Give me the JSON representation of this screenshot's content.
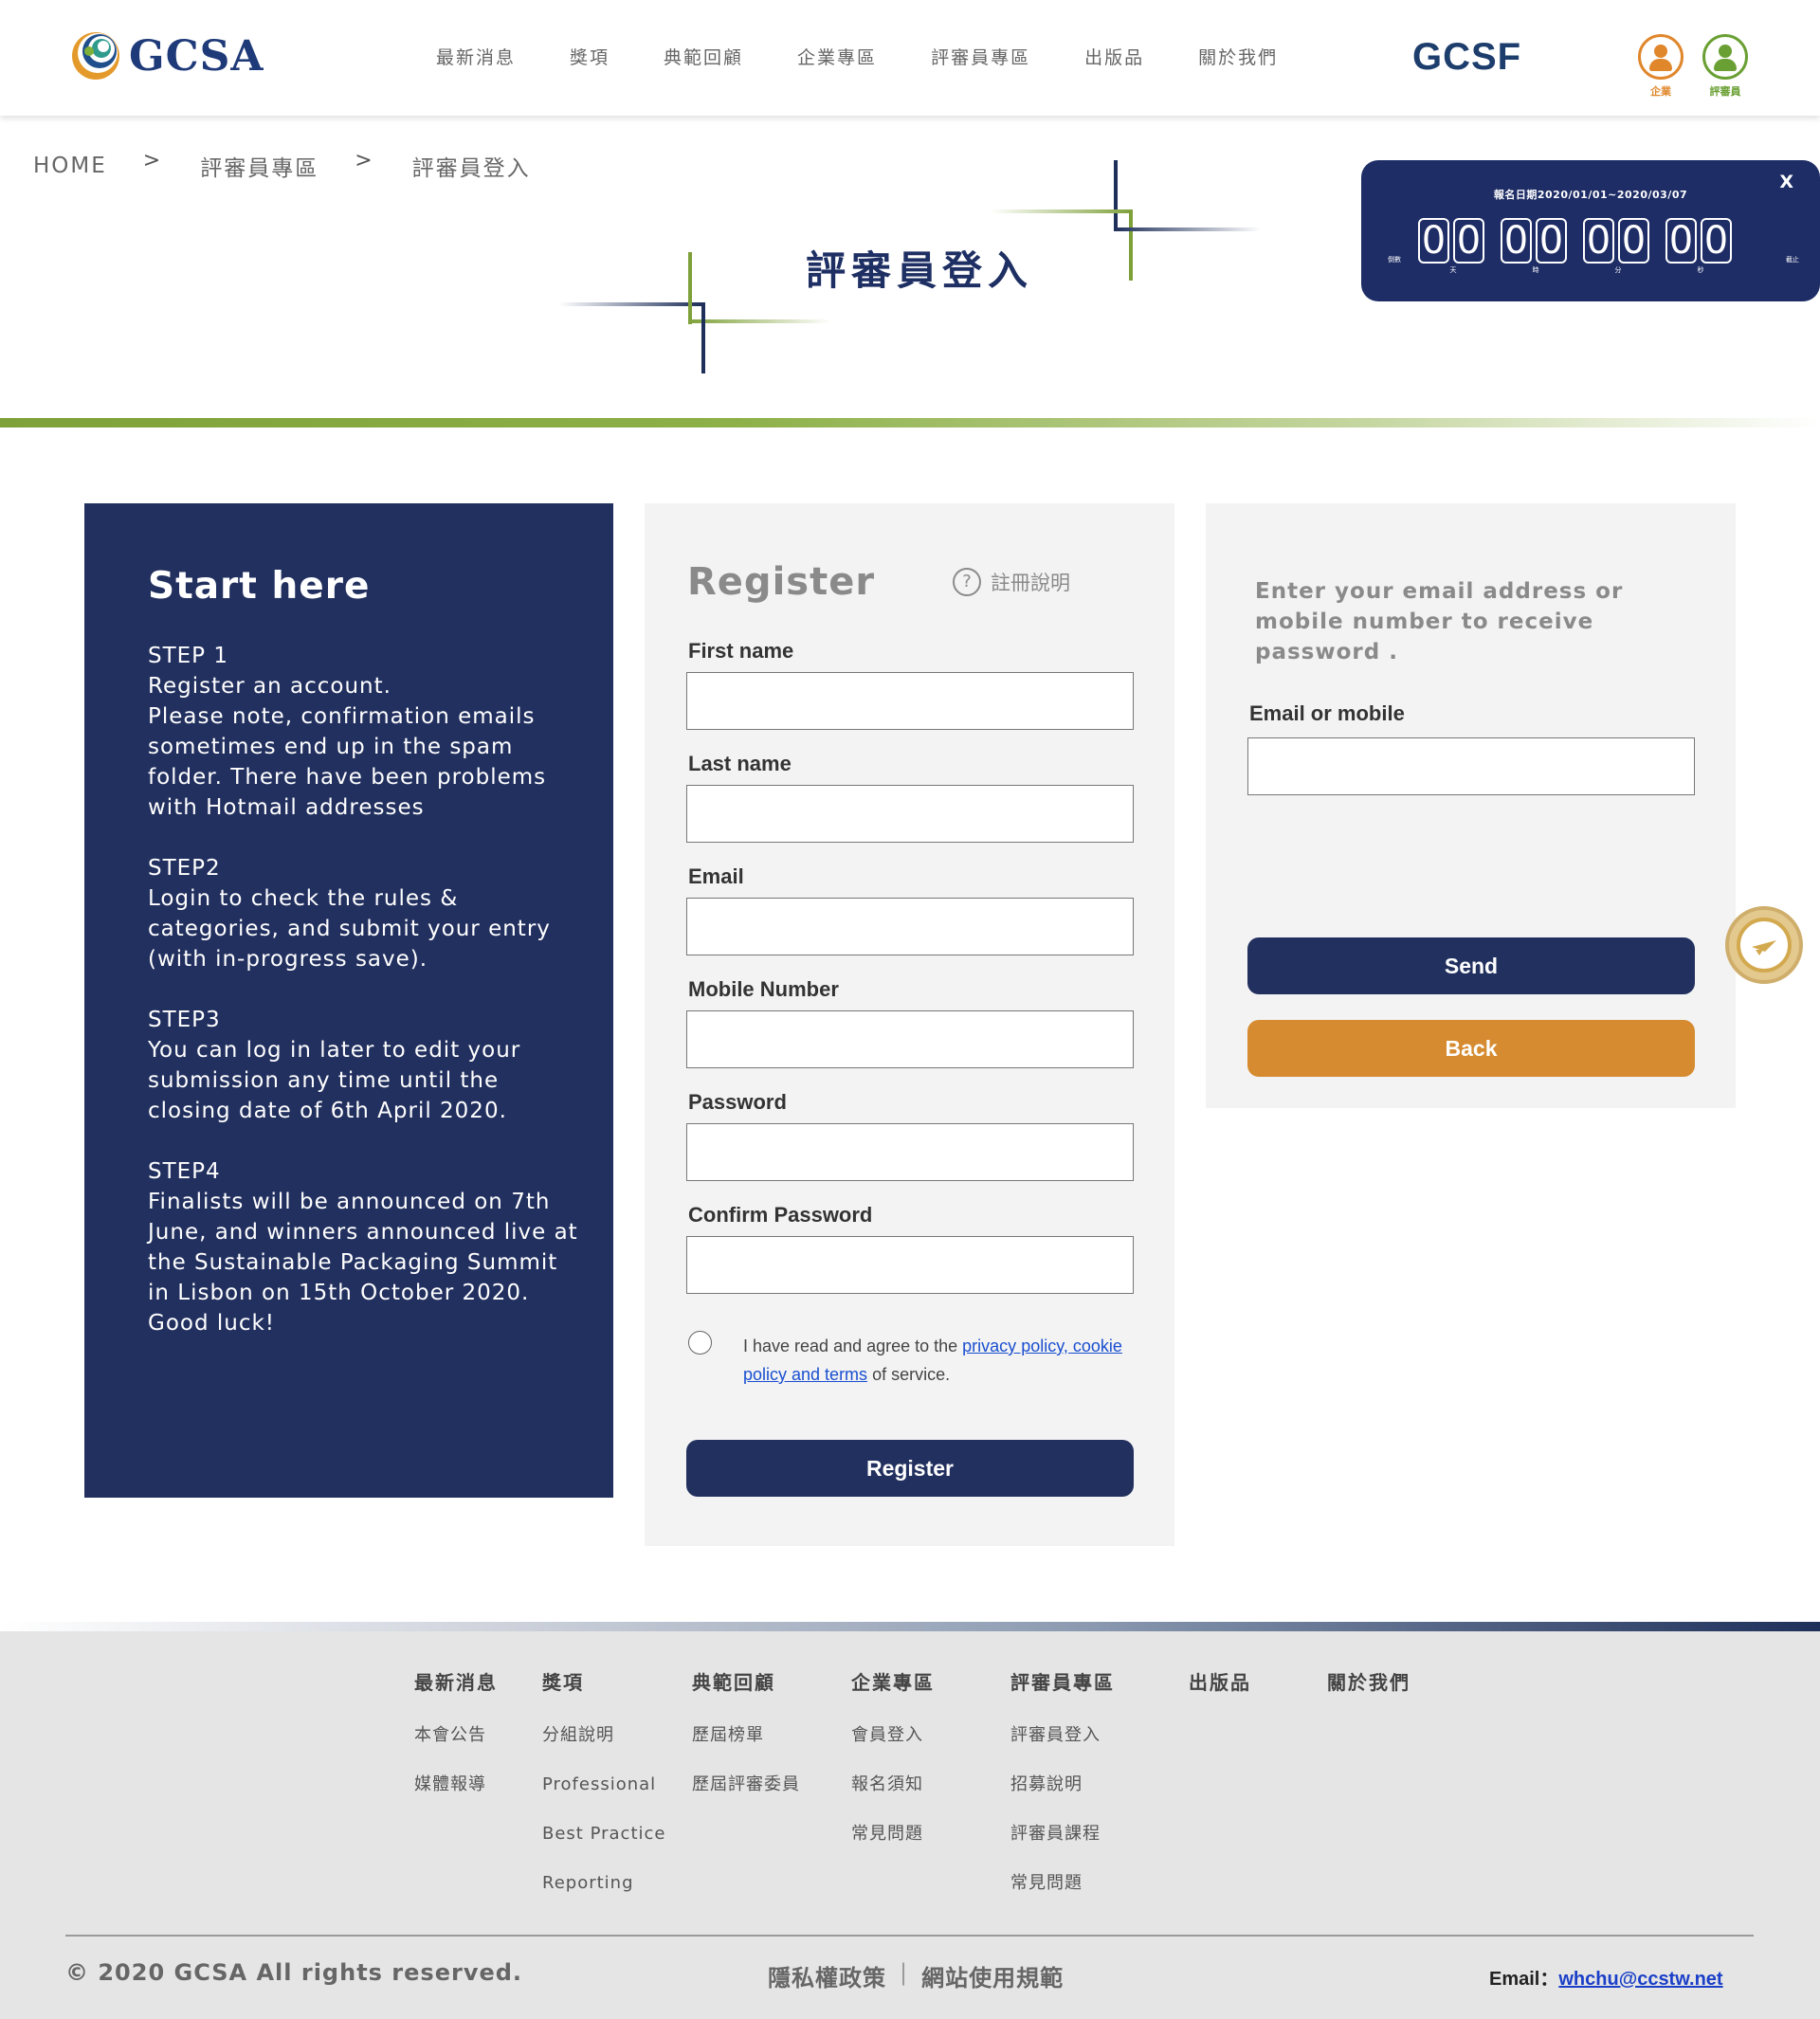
{
  "header": {
    "logo_text": "GCSA",
    "nav": [
      "最新消息",
      "獎項",
      "典範回顧",
      "企業專區",
      "評審員專區",
      "出版品",
      "關於我們"
    ],
    "partner_logo": "GCSF",
    "user_buttons": [
      {
        "label": "企業",
        "icon": "user-icon",
        "color": "#e0872c"
      },
      {
        "label": "評審員",
        "icon": "user-icon",
        "color": "#6aa033"
      }
    ]
  },
  "breadcrumb": {
    "items": [
      "HOME",
      "評審員專區",
      "評審員登入"
    ],
    "separator": ">"
  },
  "page_title": "評審員登入",
  "countdown": {
    "date_range": "報名日期2020/01/01~2020/03/07",
    "close": "X",
    "left_label": "倒數",
    "right_label": "截止",
    "groups": [
      {
        "value": "00",
        "unit": "天"
      },
      {
        "value": "00",
        "unit": "時"
      },
      {
        "value": "00",
        "unit": "分"
      },
      {
        "value": "00",
        "unit": "秒"
      }
    ]
  },
  "start": {
    "title": "Start here",
    "steps": [
      {
        "heading": "STEP 1",
        "text": "Register an account.\nPlease note, confirmation emails sometimes end up in the spam folder. There have been problems with Hotmail addresses"
      },
      {
        "heading": "STEP2",
        "text": "Login to check the rules & categories, and submit your entry (with in-progress save)."
      },
      {
        "heading": "STEP3",
        "text": "You can log in later to edit your submission any time until the closing date of 6th April 2020."
      },
      {
        "heading": "STEP4",
        "text": "Finalists will be announced on 7th June, and winners announced live at the Sustainable Packaging Summit in Lisbon on 15th October 2020.\nGood luck!"
      }
    ]
  },
  "register": {
    "title": "Register",
    "help_label": "註冊說明",
    "fields": [
      {
        "label": "First name",
        "value": "",
        "placeholder": ""
      },
      {
        "label": "Last name",
        "value": "",
        "placeholder": ""
      },
      {
        "label": "Email",
        "value": "",
        "placeholder": ""
      },
      {
        "label": "Mobile Number",
        "value": "",
        "placeholder": ""
      },
      {
        "label": "Password",
        "value": "",
        "placeholder": ""
      },
      {
        "label": "Confirm Password",
        "value": "",
        "placeholder": ""
      }
    ],
    "agree_prefix": "I have read and agree to the ",
    "agree_link": "privacy policy, cookie policy and terms",
    "agree_suffix": " of service.",
    "agree_checked": false,
    "submit_label": "Register"
  },
  "recover": {
    "prompt": "Enter your email address or mobile number to receive password .",
    "field_label": "Email or mobile",
    "field_value": "",
    "send_label": "Send",
    "back_label": "Back"
  },
  "footer": {
    "columns": [
      {
        "heading": "最新消息",
        "links": [
          "本會公告",
          "媒體報導"
        ]
      },
      {
        "heading": "獎項",
        "links": [
          "分組說明",
          "Professional",
          "Best Practice",
          "Reporting"
        ]
      },
      {
        "heading": "典範回顧",
        "links": [
          "歷屆榜單",
          "歷屆評審委員"
        ]
      },
      {
        "heading": "企業專區",
        "links": [
          "會員登入",
          "報名須知",
          "常見問題"
        ]
      },
      {
        "heading": "評審員專區",
        "links": [
          "評審員登入",
          "招募說明",
          "評審員課程",
          "常見問題"
        ]
      },
      {
        "heading": "出版品",
        "links": []
      },
      {
        "heading": "關於我們",
        "links": []
      }
    ],
    "copyright": "© 2020 GCSA All rights reserved.",
    "policy_links": [
      "隱私權政策",
      "網站使用規範"
    ],
    "policy_separator": "|",
    "email_label": "Email：",
    "email": "whchu@ccstw.net"
  }
}
